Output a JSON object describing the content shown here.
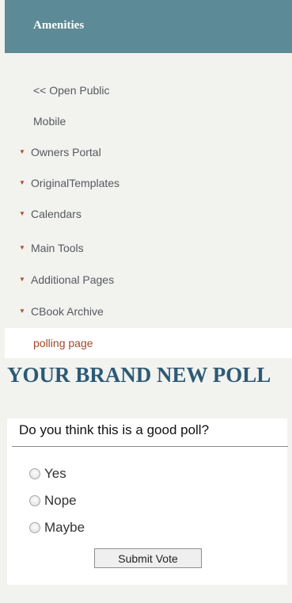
{
  "header": {
    "title": "Amenities"
  },
  "nav": {
    "items": [
      {
        "label": "<< Open Public",
        "caret": false
      },
      {
        "label": "Mobile",
        "caret": false
      },
      {
        "label": "Owners Portal",
        "caret": true
      },
      {
        "label": "OriginalTemplates",
        "caret": true
      },
      {
        "label": "Calendars",
        "caret": true
      },
      {
        "label": "Main Tools",
        "caret": true
      },
      {
        "label": "Additional Pages",
        "caret": true
      },
      {
        "label": "CBook Archive",
        "caret": true
      },
      {
        "label": "polling page",
        "caret": false,
        "active": true
      }
    ]
  },
  "poll": {
    "title": "YOUR BRAND NEW POLL",
    "question": "Do you think this is a good poll?",
    "options": [
      "Yes",
      "Nope",
      "Maybe"
    ],
    "submit_label": "Submit Vote"
  },
  "colors": {
    "header_bg": "#5c8a97",
    "caret": "#b24a2e",
    "active_link": "#a0492a",
    "poll_title": "#2c5a75"
  }
}
